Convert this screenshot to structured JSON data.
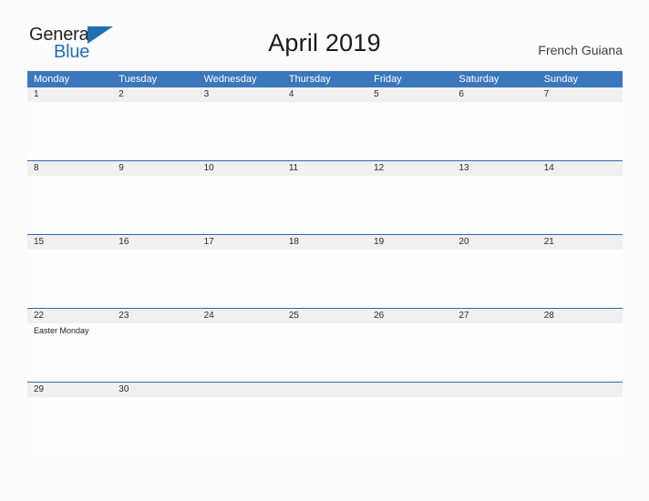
{
  "brand": {
    "word_general": "General",
    "word_blue": "Blue",
    "flag_icon": "blue-triangle-flag-icon",
    "accent_color": "#1f6fb5"
  },
  "header": {
    "title": "April 2019",
    "subtitle": "French Guiana"
  },
  "theme": {
    "header_blue": "#3b77bc",
    "row_divider_blue": "#2a6cb0",
    "day_band_grey": "#f0f0f0",
    "page_background": "#fcfcfd",
    "text_dark": "#2b2b2b"
  },
  "calendar": {
    "weekdays": [
      "Monday",
      "Tuesday",
      "Wednesday",
      "Thursday",
      "Friday",
      "Saturday",
      "Sunday"
    ],
    "weeks": [
      {
        "days": [
          {
            "number": "1",
            "events": []
          },
          {
            "number": "2",
            "events": []
          },
          {
            "number": "3",
            "events": []
          },
          {
            "number": "4",
            "events": []
          },
          {
            "number": "5",
            "events": []
          },
          {
            "number": "6",
            "events": []
          },
          {
            "number": "7",
            "events": []
          }
        ]
      },
      {
        "days": [
          {
            "number": "8",
            "events": []
          },
          {
            "number": "9",
            "events": []
          },
          {
            "number": "10",
            "events": []
          },
          {
            "number": "11",
            "events": []
          },
          {
            "number": "12",
            "events": []
          },
          {
            "number": "13",
            "events": []
          },
          {
            "number": "14",
            "events": []
          }
        ]
      },
      {
        "days": [
          {
            "number": "15",
            "events": []
          },
          {
            "number": "16",
            "events": []
          },
          {
            "number": "17",
            "events": []
          },
          {
            "number": "18",
            "events": []
          },
          {
            "number": "19",
            "events": []
          },
          {
            "number": "20",
            "events": []
          },
          {
            "number": "21",
            "events": []
          }
        ]
      },
      {
        "days": [
          {
            "number": "22",
            "events": [
              "Easter Monday"
            ]
          },
          {
            "number": "23",
            "events": []
          },
          {
            "number": "24",
            "events": []
          },
          {
            "number": "25",
            "events": []
          },
          {
            "number": "26",
            "events": []
          },
          {
            "number": "27",
            "events": []
          },
          {
            "number": "28",
            "events": []
          }
        ]
      },
      {
        "days": [
          {
            "number": "29",
            "events": []
          },
          {
            "number": "30",
            "events": []
          },
          {
            "number": "",
            "events": []
          },
          {
            "number": "",
            "events": []
          },
          {
            "number": "",
            "events": []
          },
          {
            "number": "",
            "events": []
          },
          {
            "number": "",
            "events": []
          }
        ]
      }
    ]
  }
}
